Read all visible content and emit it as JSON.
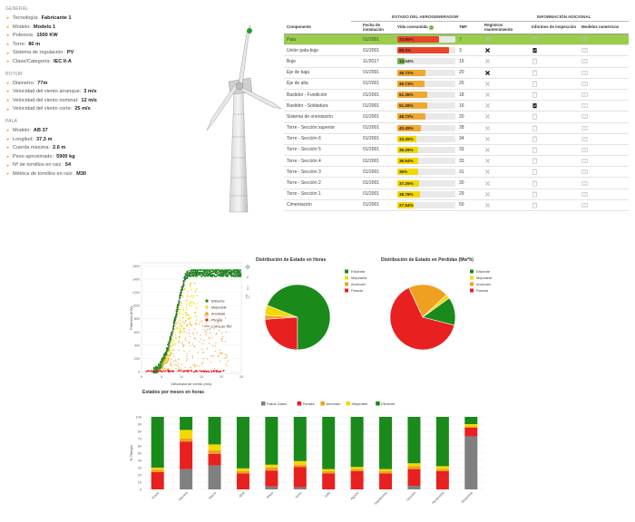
{
  "general": {
    "title": "GENERAL",
    "items": [
      {
        "label": "Tecnología:",
        "value": "Fabricante 1"
      },
      {
        "label": "Modelo:",
        "value": "Modelo 1"
      },
      {
        "label": "Potencia:",
        "value": "1500 KW"
      },
      {
        "label": "Torre:",
        "value": "80 m"
      },
      {
        "label": "Sistema de regulación:",
        "value": "PV"
      },
      {
        "label": "Clase/Categoría:",
        "value": "IEC II-A"
      }
    ]
  },
  "rotor": {
    "title": "ROTOR",
    "items": [
      {
        "label": "Diámetro:",
        "value": "77m"
      },
      {
        "label": "Velocidad del viento arranque:",
        "value": "3 m/s"
      },
      {
        "label": "Velocidad del viento nominal:",
        "value": "12 m/s"
      },
      {
        "label": "Velocidad del viento corte:",
        "value": "25 m/s"
      }
    ]
  },
  "pala": {
    "title": "PALA",
    "items": [
      {
        "label": "Modelo:",
        "value": "AB 37"
      },
      {
        "label": "Longitud:",
        "value": "37.3 m"
      },
      {
        "label": "Cuerda máxima:",
        "value": "2.6 m"
      },
      {
        "label": "Peso aproximado:",
        "value": "5900 kg"
      },
      {
        "label": "Nº de tornillos en raíz:",
        "value": "54"
      },
      {
        "label": "Métrica de tornillos en raíz:",
        "value": "M30"
      }
    ]
  },
  "table": {
    "group1": "ESTADO DEL AEROGENERADOR",
    "group2": "INFORMACIÓN ADICIONAL",
    "headers": [
      "Componente",
      "Fecha de instalación",
      "Vida consumida",
      "TMF",
      "Registros mantenimiento",
      "Informes de inspección",
      "Modelos numéricos"
    ],
    "rows": [
      {
        "comp": "Pala",
        "date": "01/2001",
        "life": "72.60%",
        "pct": 72.6,
        "color": "#e8462a",
        "tmf": "7",
        "reg": "x",
        "inf": "clip",
        "mod": "doc",
        "hl": true
      },
      {
        "comp": "Unión pala-buje",
        "date": "01/2001",
        "life": "88.3%",
        "pct": 88.3,
        "color": "#e8462a",
        "tmf": "3",
        "reg": "fan",
        "inf": "check",
        "mod": "doc",
        "hl": false
      },
      {
        "comp": "Buje",
        "date": "11/2017",
        "life": "13.04%",
        "pct": 13.04,
        "color": "#7ab648",
        "tmf": "15",
        "reg": "x",
        "inf": "clip",
        "mod": "doc",
        "hl": false
      },
      {
        "comp": "Eje de baja",
        "date": "01/2001",
        "life": "48.72%",
        "pct": 48.72,
        "color": "#f0a830",
        "tmf": "20",
        "reg": "fan",
        "inf": "clip",
        "mod": "doc",
        "hl": false
      },
      {
        "comp": "Eje de alta",
        "date": "01/2001",
        "life": "46.73%",
        "pct": 46.73,
        "color": "#f0a830",
        "tmf": "25",
        "reg": "x",
        "inf": "clip",
        "mod": "doc",
        "hl": false
      },
      {
        "comp": "Bastidor - Fundición",
        "date": "01/2001",
        "life": "51.35%",
        "pct": 51.35,
        "color": "#f0a830",
        "tmf": "18",
        "reg": "x",
        "inf": "clip",
        "mod": "doc",
        "hl": false
      },
      {
        "comp": "Bastidor - Soldadura",
        "date": "01/2001",
        "life": "51.26%",
        "pct": 51.26,
        "color": "#f0a830",
        "tmf": "16",
        "reg": "x",
        "inf": "check",
        "mod": "doc",
        "hl": false
      },
      {
        "comp": "Sistema de orientación",
        "date": "01/2001",
        "life": "48.72%",
        "pct": 48.72,
        "color": "#f0a830",
        "tmf": "20",
        "reg": "x",
        "inf": "clip",
        "mod": "doc",
        "hl": false
      },
      {
        "comp": "Torre - Sección superior",
        "date": "01/2001",
        "life": "40.45%",
        "pct": 40.45,
        "color": "#f0a830",
        "tmf": "28",
        "reg": "x",
        "inf": "clip",
        "mod": "doc",
        "hl": false
      },
      {
        "comp": "Torre - Sección 6",
        "date": "01/2001",
        "life": "33.35%",
        "pct": 33.35,
        "color": "#f5d800",
        "tmf": "34",
        "reg": "x",
        "inf": "clip",
        "mod": "doc",
        "hl": false
      },
      {
        "comp": "Torre - Sección 5",
        "date": "01/2001",
        "life": "35.29%",
        "pct": 35.29,
        "color": "#f5d800",
        "tmf": "33",
        "reg": "x",
        "inf": "clip",
        "mod": "doc",
        "hl": false
      },
      {
        "comp": "Torre - Sección 4",
        "date": "01/2001",
        "life": "36.54%",
        "pct": 36.54,
        "color": "#f5d800",
        "tmf": "33",
        "reg": "x",
        "inf": "clip",
        "mod": "doc",
        "hl": false
      },
      {
        "comp": "Torre - Sección 3",
        "date": "01/2001",
        "life": "36%",
        "pct": 36,
        "color": "#f5d800",
        "tmf": "31",
        "reg": "x",
        "inf": "clip",
        "mod": "doc",
        "hl": false
      },
      {
        "comp": "Torre - Sección 2",
        "date": "01/2001",
        "life": "37.25%",
        "pct": 37.25,
        "color": "#f5d800",
        "tmf": "30",
        "reg": "x",
        "inf": "clip",
        "mod": "doc",
        "hl": false
      },
      {
        "comp": "Torre - Sección 1",
        "date": "01/2001",
        "life": "38.78%",
        "pct": 38.78,
        "color": "#f5d800",
        "tmf": "29",
        "reg": "x",
        "inf": "clip",
        "mod": "doc",
        "hl": false
      },
      {
        "comp": "Cimentación",
        "date": "01/2001",
        "life": "27.54%",
        "pct": 27.54,
        "color": "#f5d800",
        "tmf": "50",
        "reg": "x",
        "inf": "clip",
        "mod": "doc",
        "hl": false
      }
    ]
  },
  "colors": {
    "eficiente": "#1a8a1a",
    "mejorable": "#f5d800",
    "anomalo": "#f0a020",
    "parada": "#e82020",
    "fallos": "#808080"
  },
  "scatter": {
    "ylabel": "Potencia (KW)",
    "xlabel": "Velocidad de viento (m/s)",
    "legend": [
      "Eficiente",
      "Mejorable",
      "Anomalo",
      "Parada",
      "Curva de Ref"
    ]
  },
  "chart_data": [
    {
      "type": "scatter",
      "title": "",
      "xlabel": "Velocidad de viento (m/s)",
      "ylabel": "Potencia (KW)",
      "xlim": [
        0,
        25
      ],
      "ylim": [
        -30,
        1650
      ],
      "xticks": [
        0,
        5,
        10,
        15,
        20,
        25
      ],
      "yticks": [
        0,
        200,
        400,
        600,
        800,
        1000,
        1200,
        1400,
        1600
      ],
      "series": [
        {
          "name": "Eficiente",
          "color": "#1a8a1a"
        },
        {
          "name": "Mejorable",
          "color": "#f5d800"
        },
        {
          "name": "Anomalo",
          "color": "#f0a020"
        },
        {
          "name": "Parada",
          "color": "#e82020"
        },
        {
          "name": "Curva de Ref",
          "color": "#555555",
          "x": [
            3,
            4,
            5,
            6,
            7,
            8,
            9,
            10,
            11,
            12,
            25
          ],
          "y": [
            0,
            40,
            120,
            250,
            430,
            680,
            950,
            1230,
            1440,
            1500,
            1500
          ]
        }
      ],
      "legend": "middle-right"
    },
    {
      "type": "pie",
      "title": "Distribución de Estado en Horas",
      "categories": [
        "Eficiente",
        "Mejorable",
        "Anomalo",
        "Parada"
      ],
      "values": [
        69,
        5,
        2,
        24
      ],
      "legend": "right"
    },
    {
      "type": "pie",
      "title": "Distribución de Estado en Pérdidas (Mw*h)",
      "categories": [
        "Eficiente",
        "Mejorable",
        "Anomalo",
        "Parada"
      ],
      "values": [
        14,
        2,
        20,
        64
      ],
      "legend": "right"
    },
    {
      "type": "bar",
      "stacked": true,
      "title": "Estados por meses en horas",
      "ylabel": "% Tiempo",
      "ylim": [
        0,
        100
      ],
      "yticks": [
        0,
        10,
        20,
        30,
        40,
        50,
        60,
        70,
        80,
        90,
        100
      ],
      "categories": [
        "Enero",
        "Febrero",
        "Marzo",
        "Abril",
        "Mayo",
        "Junio",
        "Julio",
        "Agosto",
        "Septiembre",
        "Octubre",
        "Noviembre",
        "Diciembre"
      ],
      "series": [
        {
          "name": "Fallos Datos",
          "values": [
            0,
            28,
            33,
            0,
            4,
            3,
            0,
            0,
            0,
            5,
            0,
            73
          ]
        },
        {
          "name": "Parada",
          "values": [
            24,
            38,
            16,
            22,
            22,
            28,
            22,
            25,
            22,
            23,
            25,
            12
          ]
        },
        {
          "name": "Anomalo",
          "values": [
            3,
            4,
            5,
            3,
            4,
            3,
            3,
            3,
            3,
            4,
            3,
            2
          ]
        },
        {
          "name": "Mejorable",
          "values": [
            3,
            12,
            8,
            4,
            4,
            5,
            3,
            3,
            3,
            4,
            4,
            3
          ]
        },
        {
          "name": "Eficiente",
          "values": [
            70,
            18,
            38,
            71,
            66,
            61,
            72,
            69,
            72,
            64,
            68,
            10
          ]
        }
      ]
    }
  ],
  "pie1": {
    "title": "Distribución de Estado en Horas"
  },
  "pie2": {
    "title": "Distribución de Estado en Pérdidas (Mw*h)"
  },
  "stacked": {
    "title": "Estados por meses en horas",
    "ylabel": "% Tiempo",
    "legend": [
      "Fallos Datos",
      "Parada",
      "Anomalo",
      "Mejorable",
      "Eficiente"
    ]
  },
  "legend_pie": [
    "Eficiente",
    "Mejorable",
    "Anomalo",
    "Parada"
  ]
}
